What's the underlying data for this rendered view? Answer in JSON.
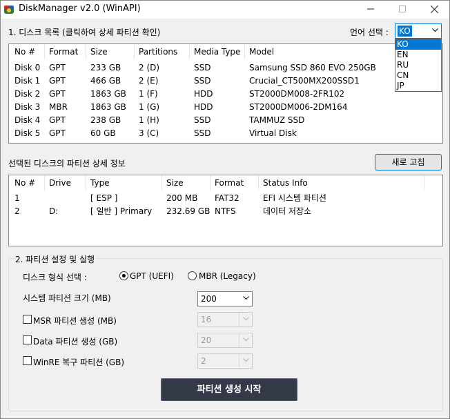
{
  "window": {
    "title": "DiskManager v2.0 (WinAPI)"
  },
  "disk_section": {
    "title": "1. 디스크 목록 (클릭하여 상세 파티션 확인)"
  },
  "language": {
    "label": "언어 선택 :",
    "selected": "KO",
    "options": [
      "KO",
      "EN",
      "RU",
      "CN",
      "JP"
    ]
  },
  "disk_table": {
    "columns": [
      "No #",
      "Format",
      "Size",
      "Partitions",
      "Media Type",
      "Model"
    ],
    "rows": [
      [
        "Disk 0",
        "GPT",
        "233 GB",
        "2 (D)",
        "SSD",
        "Samsung SSD 860 EVO 250GB"
      ],
      [
        "Disk 1",
        "GPT",
        "466 GB",
        "2 (E)",
        "SSD",
        "Crucial_CT500MX200SSD1"
      ],
      [
        "Disk 2",
        "GPT",
        "1863 GB",
        "1 (F)",
        "HDD",
        "ST2000DM008-2FR102"
      ],
      [
        "Disk 3",
        "MBR",
        "1863 GB",
        "1 (G)",
        "HDD",
        "ST2000DM006-2DM164"
      ],
      [
        "Disk 4",
        "GPT",
        "238 GB",
        "1 (H)",
        "SSD",
        "TAMMUZ SSD"
      ],
      [
        "Disk 5",
        "GPT",
        "60 GB",
        "3 (C)",
        "SSD",
        "Virtual Disk"
      ]
    ]
  },
  "partition_section": {
    "title": "선택된 디스크의 파티션 상세 정보",
    "refresh_label": "새로 고침"
  },
  "partition_table": {
    "columns": [
      "No #",
      "Drive",
      "Type",
      "Size",
      "Format",
      "Status Info"
    ],
    "rows": [
      [
        "1",
        "",
        "[ ESP ]",
        "200 MB",
        "FAT32",
        "EFI 시스템 파티션"
      ],
      [
        "2",
        "D:",
        "[ 일반 ] Primary",
        "232.69 GB",
        "NTFS",
        "데이터 저장소"
      ]
    ]
  },
  "settings": {
    "title": "2. 파티션 설정 및 실행",
    "disk_format_label": "디스크 형식 선택 :",
    "gpt_label": "GPT (UEFI)",
    "mbr_label": "MBR (Legacy)",
    "gpt_selected": true,
    "system_size_label": "시스템 파티션 크기 (MB)",
    "system_size_value": "200",
    "msr_label": "MSR 파티션 생성 (MB)",
    "msr_value": "16",
    "data_label": "Data 파티션 생성 (GB)",
    "data_value": "20",
    "winre_label": "WinRE 복구 파티션 (GB)",
    "winre_value": "2",
    "start_label": "파티션 생성 시작"
  }
}
